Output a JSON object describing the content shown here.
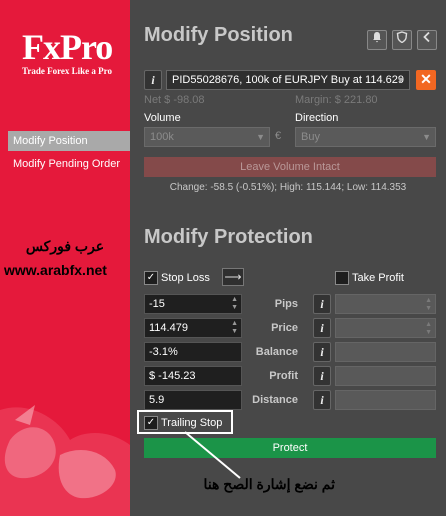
{
  "sidebar": {
    "logo": "FxPro",
    "tagline": "Trade Forex Like a Pro",
    "items": [
      {
        "label": "Modify Position",
        "active": true
      },
      {
        "label": "Modify Pending Order",
        "active": false
      }
    ],
    "watermark_arabic": "عرب فوركس",
    "watermark_url": "www.arabfx.net"
  },
  "modify_position": {
    "title": "Modify Position",
    "header_icons": [
      "bell-icon",
      "shield-icon",
      "chevron-left-icon"
    ],
    "info_icon": "i",
    "position_value": "PID55028676, 100k of EURJPY Buy at 114.629",
    "close_icon": "✕",
    "net": "Net $ -98.08",
    "margin": "Margin: $ 221.80",
    "volume_label": "Volume",
    "volume_value": "100k",
    "currency_symbol": "€",
    "direction_label": "Direction",
    "direction_value": "Buy",
    "leave_volume_button": "Leave Volume Intact",
    "change_line": "Change: -58.5 (-0.51%); High: 115.144; Low: 114.353"
  },
  "modify_protection": {
    "title": "Modify Protection",
    "stop_loss_label": "Stop Loss",
    "stop_loss_checked": true,
    "take_profit_label": "Take Profit",
    "take_profit_checked": false,
    "rows": [
      {
        "value": "-15",
        "label": "Pips",
        "spinner": true
      },
      {
        "value": "114.479",
        "label": "Price",
        "spinner": true
      },
      {
        "value": "-3.1%",
        "label": "Balance",
        "spinner": false
      },
      {
        "value": "$ -145.23",
        "label": "Profit",
        "spinner": false
      },
      {
        "value": "5.9",
        "label": "Distance",
        "spinner": false
      }
    ],
    "trailing_stop_label": "Trailing Stop",
    "trailing_stop_checked": true,
    "protect_button": "Protect"
  },
  "annotation": {
    "note_arabic": "ثم نضع إشارة الصح هنا"
  },
  "colors": {
    "brand_red": "#e5193b",
    "panel_bg": "#484848",
    "close_orange": "#f26722",
    "protect_green": "#1b9448"
  }
}
